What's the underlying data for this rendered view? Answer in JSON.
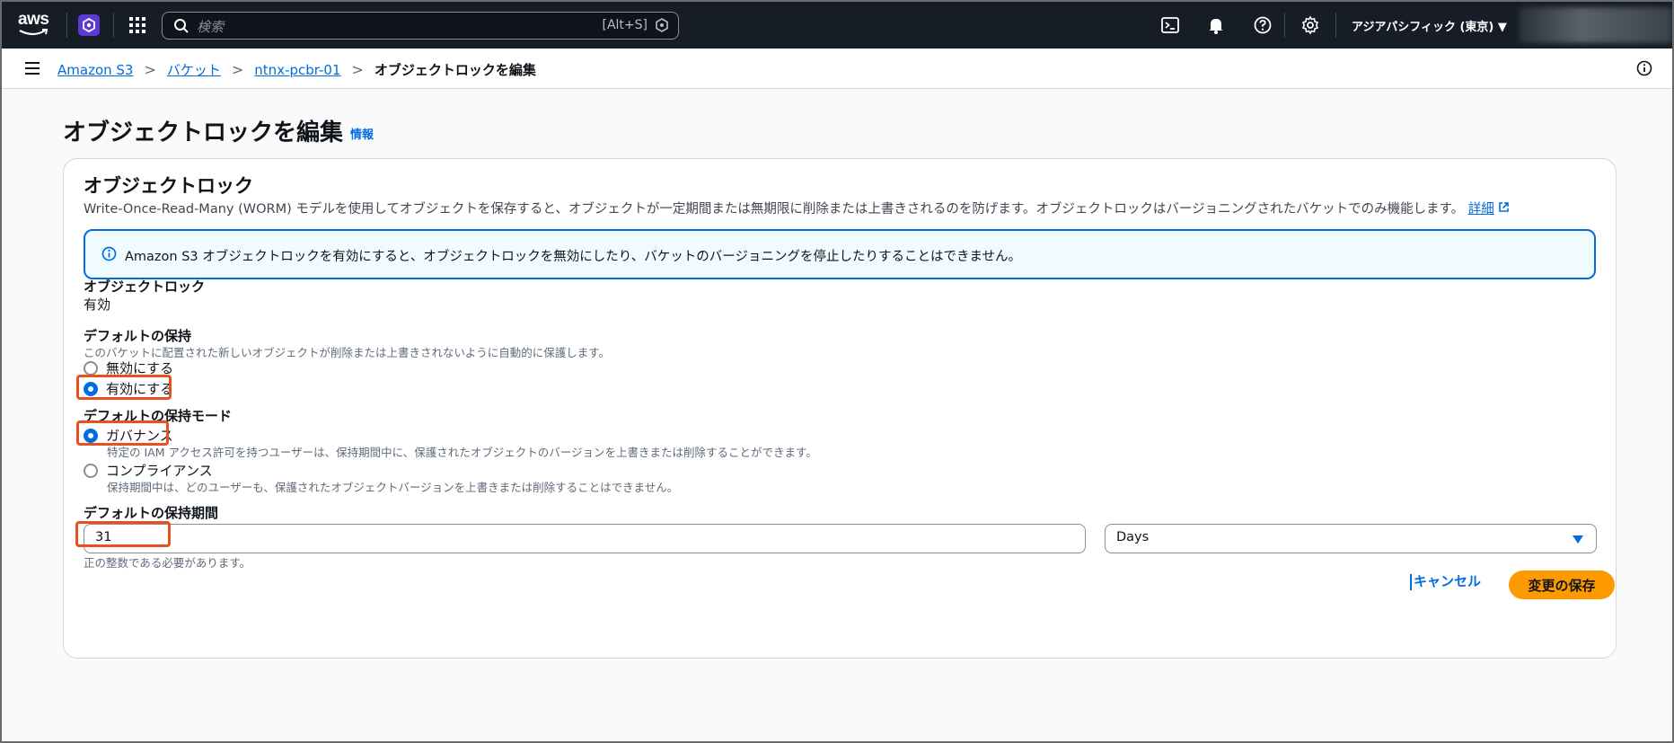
{
  "topnav": {
    "logo_text": "aws",
    "search_placeholder": "検索",
    "search_shortcut": "[Alt+S]",
    "region": "アジアパシフィック (東京) ▼"
  },
  "breadcrumb": {
    "items": [
      "Amazon S3",
      "バケット",
      "ntnx-pcbr-01"
    ],
    "current": "オブジェクトロックを編集"
  },
  "page": {
    "title": "オブジェクトロックを編集",
    "info_link": "情報"
  },
  "card": {
    "title": "オブジェクトロック",
    "description": "Write-Once-Read-Many (WORM) モデルを使用してオブジェクトを保存すると、オブジェクトが一定期間または無期限に削除または上書きされるのを防げます。オブジェクトロックはバージョニングされたバケットでのみ機能します。",
    "details_link": "詳細",
    "alert": "Amazon S3 オブジェクトロックを有効にすると、オブジェクトロックを無効にしたり、バケットのバージョニングを停止したりすることはできません。",
    "lock_label": "オブジェクトロック",
    "lock_value": "有効",
    "retention": {
      "label": "デフォルトの保持",
      "description": "このバケットに配置された新しいオブジェクトが削除または上書きされないように自動的に保護します。",
      "options": [
        "無効にする",
        "有効にする"
      ],
      "selected": "有効にする"
    },
    "mode": {
      "label": "デフォルトの保持モード",
      "options": [
        {
          "label": "ガバナンス",
          "description": "特定の IAM アクセス許可を持つユーザーは、保持期間中に、保護されたオブジェクトのバージョンを上書きまたは削除することができます。"
        },
        {
          "label": "コンプライアンス",
          "description": "保持期間中は、どのユーザーも、保護されたオブジェクトバージョンを上書きまたは削除することはできません。"
        }
      ],
      "selected": "ガバナンス"
    },
    "period": {
      "label": "デフォルトの保持期間",
      "value": "31",
      "unit": "Days",
      "hint": "正の整数である必要があります。"
    }
  },
  "actions": {
    "cancel": "キャンセル",
    "save": "変更の保存"
  },
  "colors": {
    "nav_bg": "#161d26",
    "link": "#006ce0",
    "primary": "#ff9900",
    "highlight": "#e8501f"
  }
}
